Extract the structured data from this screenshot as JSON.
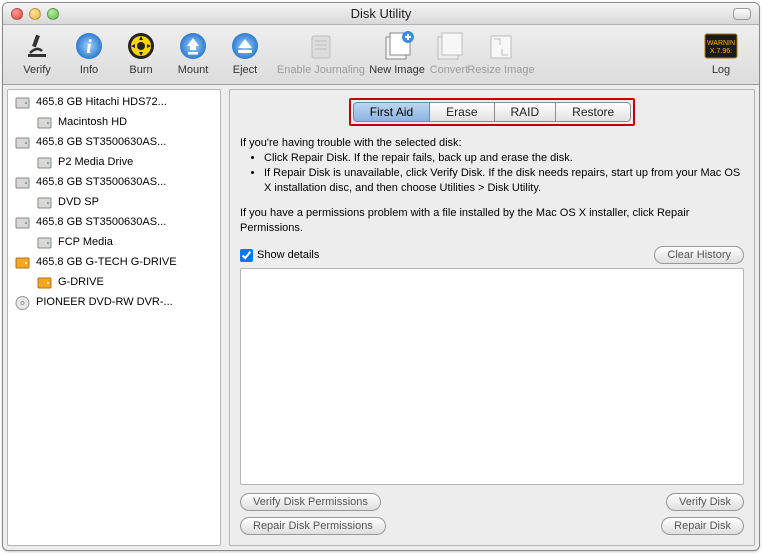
{
  "window_title": "Disk Utility",
  "toolbar": [
    {
      "label": "Verify",
      "icon": "microscope-icon",
      "disabled": false
    },
    {
      "label": "Info",
      "icon": "info-icon",
      "disabled": false
    },
    {
      "label": "Burn",
      "icon": "burn-icon",
      "disabled": false
    },
    {
      "label": "Mount",
      "icon": "mount-icon",
      "disabled": false
    },
    {
      "label": "Eject",
      "icon": "eject-icon",
      "disabled": false
    },
    {
      "label": "Enable Journaling",
      "icon": "journal-icon",
      "disabled": true,
      "wide": true
    },
    {
      "label": "New Image",
      "icon": "new-image-icon",
      "disabled": false
    },
    {
      "label": "Convert",
      "icon": "convert-icon",
      "disabled": true
    },
    {
      "label": "Resize Image",
      "icon": "resize-icon",
      "disabled": true
    }
  ],
  "log_button_label": "Log",
  "sidebar": [
    {
      "label": "465.8 GB Hitachi HDS72...",
      "icon": "internal-disk",
      "indent": 0
    },
    {
      "label": "Macintosh HD",
      "icon": "internal-disk",
      "indent": 1
    },
    {
      "label": "465.8 GB ST3500630AS...",
      "icon": "internal-disk",
      "indent": 0
    },
    {
      "label": "P2 Media Drive",
      "icon": "internal-disk",
      "indent": 1
    },
    {
      "label": "465.8 GB ST3500630AS...",
      "icon": "internal-disk",
      "indent": 0
    },
    {
      "label": "DVD SP",
      "icon": "internal-disk",
      "indent": 1
    },
    {
      "label": "465.8 GB ST3500630AS...",
      "icon": "internal-disk",
      "indent": 0
    },
    {
      "label": "FCP Media",
      "icon": "internal-disk",
      "indent": 1
    },
    {
      "label": "465.8 GB G-TECH G-DRIVE",
      "icon": "external-disk",
      "indent": 0
    },
    {
      "label": "G-DRIVE",
      "icon": "external-disk",
      "indent": 1
    },
    {
      "label": "PIONEER DVD-RW DVR-...",
      "icon": "optical-disk",
      "indent": 0
    }
  ],
  "tabs": [
    "First Aid",
    "Erase",
    "RAID",
    "Restore"
  ],
  "selected_tab": 0,
  "help_intro": "If you're having trouble with the selected disk:",
  "help_bullets": [
    "Click Repair Disk. If the repair fails, back up and erase the disk.",
    "If Repair Disk is unavailable, click Verify Disk. If the disk needs repairs, start up from your Mac OS X installation disc, and then choose Utilities > Disk Utility."
  ],
  "help_perm": "If you have a permissions problem with a file installed by the Mac OS X installer, click Repair Permissions.",
  "show_details_label": "Show details",
  "show_details_checked": true,
  "clear_history_label": "Clear History",
  "buttons": {
    "verify_perm": "Verify Disk Permissions",
    "repair_perm": "Repair Disk Permissions",
    "verify_disk": "Verify Disk",
    "repair_disk": "Repair Disk"
  }
}
